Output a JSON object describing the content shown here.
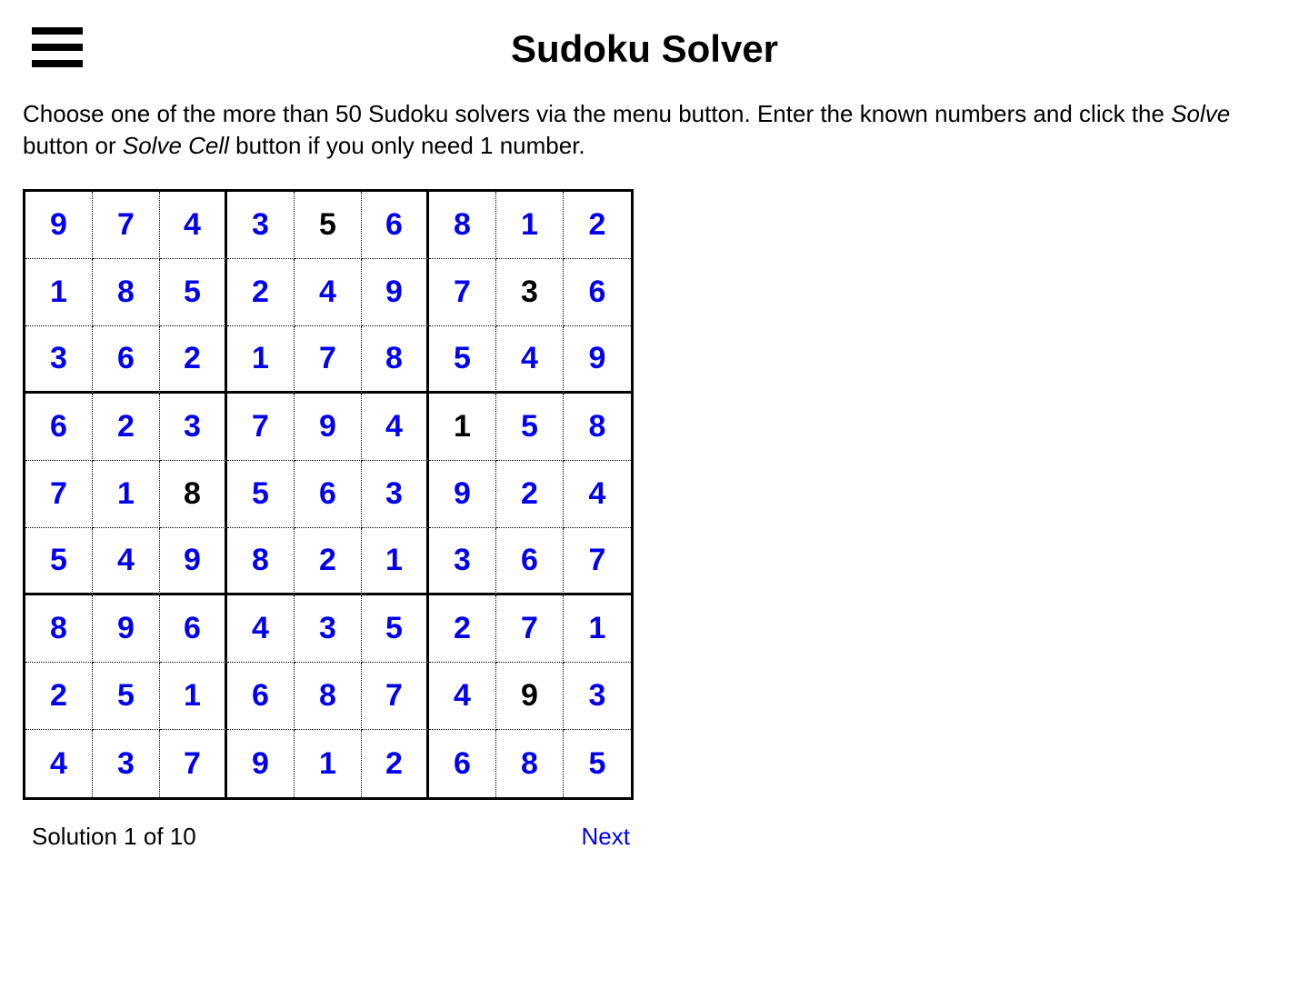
{
  "header": {
    "title": "Sudoku Solver"
  },
  "instructions": {
    "part1": "Choose one of the more than 50 Sudoku solvers via the menu button. Enter the known numbers and click the ",
    "solve": "Solve",
    "part2": " button or ",
    "solveCell": "Solve Cell",
    "part3": " button if you only need 1 number."
  },
  "grid": [
    [
      {
        "v": "9",
        "g": false
      },
      {
        "v": "7",
        "g": false
      },
      {
        "v": "4",
        "g": false
      },
      {
        "v": "3",
        "g": false
      },
      {
        "v": "5",
        "g": true
      },
      {
        "v": "6",
        "g": false
      },
      {
        "v": "8",
        "g": false
      },
      {
        "v": "1",
        "g": false
      },
      {
        "v": "2",
        "g": false
      }
    ],
    [
      {
        "v": "1",
        "g": false
      },
      {
        "v": "8",
        "g": false
      },
      {
        "v": "5",
        "g": false
      },
      {
        "v": "2",
        "g": false
      },
      {
        "v": "4",
        "g": false
      },
      {
        "v": "9",
        "g": false
      },
      {
        "v": "7",
        "g": false
      },
      {
        "v": "3",
        "g": true
      },
      {
        "v": "6",
        "g": false
      }
    ],
    [
      {
        "v": "3",
        "g": false
      },
      {
        "v": "6",
        "g": false
      },
      {
        "v": "2",
        "g": false
      },
      {
        "v": "1",
        "g": false
      },
      {
        "v": "7",
        "g": false
      },
      {
        "v": "8",
        "g": false
      },
      {
        "v": "5",
        "g": false
      },
      {
        "v": "4",
        "g": false
      },
      {
        "v": "9",
        "g": false
      }
    ],
    [
      {
        "v": "6",
        "g": false
      },
      {
        "v": "2",
        "g": false
      },
      {
        "v": "3",
        "g": false
      },
      {
        "v": "7",
        "g": false
      },
      {
        "v": "9",
        "g": false
      },
      {
        "v": "4",
        "g": false
      },
      {
        "v": "1",
        "g": true
      },
      {
        "v": "5",
        "g": false
      },
      {
        "v": "8",
        "g": false
      }
    ],
    [
      {
        "v": "7",
        "g": false
      },
      {
        "v": "1",
        "g": false
      },
      {
        "v": "8",
        "g": true
      },
      {
        "v": "5",
        "g": false
      },
      {
        "v": "6",
        "g": false
      },
      {
        "v": "3",
        "g": false
      },
      {
        "v": "9",
        "g": false
      },
      {
        "v": "2",
        "g": false
      },
      {
        "v": "4",
        "g": false
      }
    ],
    [
      {
        "v": "5",
        "g": false
      },
      {
        "v": "4",
        "g": false
      },
      {
        "v": "9",
        "g": false
      },
      {
        "v": "8",
        "g": false
      },
      {
        "v": "2",
        "g": false
      },
      {
        "v": "1",
        "g": false
      },
      {
        "v": "3",
        "g": false
      },
      {
        "v": "6",
        "g": false
      },
      {
        "v": "7",
        "g": false
      }
    ],
    [
      {
        "v": "8",
        "g": false
      },
      {
        "v": "9",
        "g": false
      },
      {
        "v": "6",
        "g": false
      },
      {
        "v": "4",
        "g": false
      },
      {
        "v": "3",
        "g": false
      },
      {
        "v": "5",
        "g": false
      },
      {
        "v": "2",
        "g": false
      },
      {
        "v": "7",
        "g": false
      },
      {
        "v": "1",
        "g": false
      }
    ],
    [
      {
        "v": "2",
        "g": false
      },
      {
        "v": "5",
        "g": false
      },
      {
        "v": "1",
        "g": false
      },
      {
        "v": "6",
        "g": false
      },
      {
        "v": "8",
        "g": false
      },
      {
        "v": "7",
        "g": false
      },
      {
        "v": "4",
        "g": false
      },
      {
        "v": "9",
        "g": true
      },
      {
        "v": "3",
        "g": false
      }
    ],
    [
      {
        "v": "4",
        "g": false
      },
      {
        "v": "3",
        "g": false
      },
      {
        "v": "7",
        "g": false
      },
      {
        "v": "9",
        "g": false
      },
      {
        "v": "1",
        "g": false
      },
      {
        "v": "2",
        "g": false
      },
      {
        "v": "6",
        "g": false
      },
      {
        "v": "8",
        "g": false
      },
      {
        "v": "5",
        "g": false
      }
    ]
  ],
  "footer": {
    "solutionLabel": "Solution 1 of 10",
    "nextLabel": "Next"
  }
}
